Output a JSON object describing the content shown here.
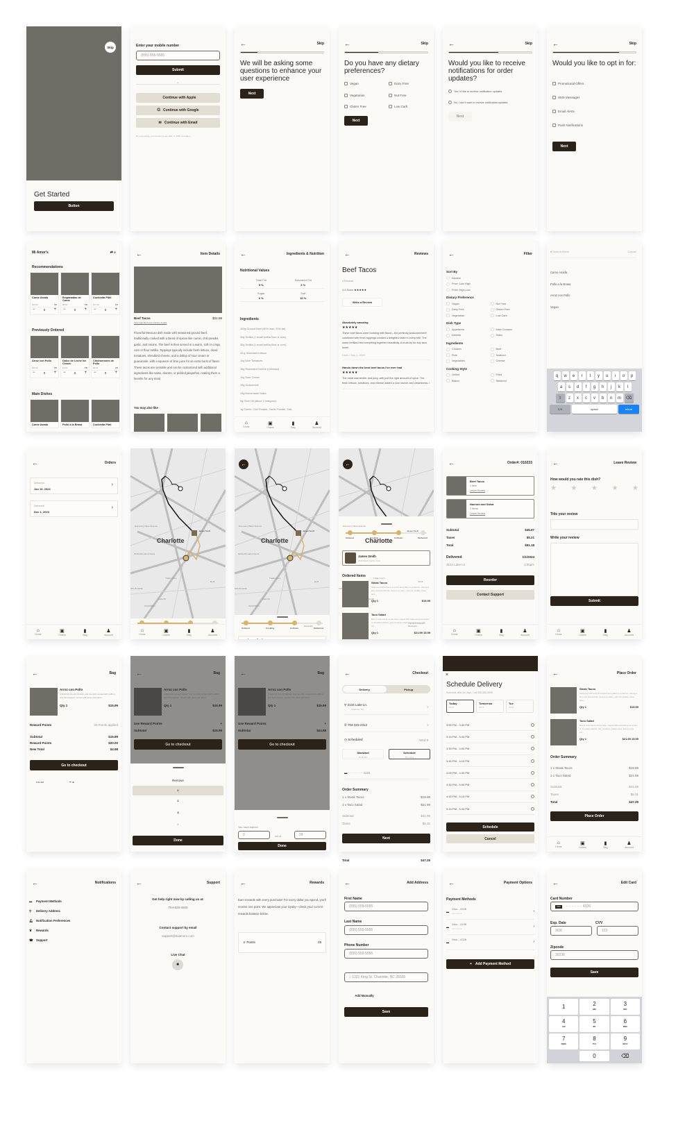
{
  "colors": {
    "primary": "#2b2219",
    "secondary": "#e2ded4",
    "placeholder": "#706d66",
    "accent": "#d9b36c",
    "background": "#fbfaf6",
    "keyboard_return": "#1a82f7"
  },
  "s1": {
    "skip": "Skip",
    "title": "Get Started",
    "button": "Button"
  },
  "s2": {
    "label": "Enter your mobile number",
    "placeholder": "(555) 555-5555",
    "submit": "Submit",
    "or": "or",
    "apple": "Continue with Apple",
    "google": "Continue with Google",
    "email": "Continue with Email",
    "consent": "By proceeding, you consent to get calls, or SMS messages"
  },
  "s3": {
    "skip": "Skip",
    "progress": 0.2,
    "title": "We will be asking some questions to enhance your user experience",
    "next": "Next"
  },
  "s4": {
    "skip": "Skip",
    "progress": 0.4,
    "title": "Do you have any dietary preferences?",
    "options": [
      "Vegan",
      "Dairy Free",
      "Vegetarian",
      "Nut Free",
      "Gluten Free",
      "Low Carb"
    ],
    "next": "Next"
  },
  "s5": {
    "skip": "Skip",
    "progress": 0.6,
    "title": "Would you like to receive notifications for order updates?",
    "options": [
      "Yes I'd like to receive notification updates",
      "No, I don't want to receive notification updates"
    ],
    "next": "Next"
  },
  "s6": {
    "skip": "Skip",
    "progress": 0.8,
    "title": "Would you like to opt in for:",
    "options": [
      "Promotional Offers",
      "SMS Messages",
      "Email Alerts",
      "Push Notifications"
    ],
    "next": "Next"
  },
  "s7": {
    "brand": "Mi Amor's",
    "rec_title": "Recommendations",
    "recs": [
      {
        "name": "Carne Asada",
        "price": "$18.99",
        "rating": "5★",
        "qty": "0"
      },
      {
        "name": "Empanadas de Carne",
        "price": "$8.99",
        "rating": "5★",
        "qty": "0"
      },
      {
        "name": "Cochinita Pibil",
        "price": "$17.99",
        "rating": "4★",
        "qty": "0"
      }
    ],
    "prev_title": "Previously Ordered",
    "prev": [
      {
        "name": "Arroz con Pollo",
        "price": "$15.99",
        "rating": "5★",
        "qty": "0"
      },
      {
        "name": "Dulce de Leche Ice Cream",
        "price": "$4.99",
        "rating": "5★",
        "qty": "0"
      },
      {
        "name": "Chicharrones de Pollo",
        "price": "$8.49",
        "rating": "4★",
        "qty": "0"
      }
    ],
    "main_title": "Main Dishes",
    "mains": [
      "Carne Asada",
      "Pollo a la Brasa",
      "Cochinita Pibil"
    ]
  },
  "s8": {
    "title": "Item Details",
    "name": "Beef Tacos",
    "price": "$21.99",
    "link": "View ingredient and nutrition details",
    "desc": "Flavorful Mexican dish made with seasoned ground beef, traditionally cooked with a blend of spices like cumin, chili powder, garlic, and onions. The beef is then served in a warm, soft or crispy corn or flour tortilla. Toppings typically include fresh lettuce, diced tomatoes, shredded cheese, and a dollop of sour cream or guacamole, with a squeeze of lime juice for an extra burst of flavor. These tacos are versatile and can be customized with additional ingredients like salsa, cilantro, or pickled jalapeños, making them a favorite for any meal.",
    "also": "You may also like"
  },
  "s9": {
    "title": "Ingredients & Nutrition",
    "nv": "Nutritional Values",
    "nutrients": [
      {
        "k": "Total Fat",
        "v": "5 %"
      },
      {
        "k": "Saturated Fat",
        "v": "2 %"
      },
      {
        "k": "Sugar",
        "v": "6 %"
      },
      {
        "k": "Salt",
        "v": "10 %"
      }
    ],
    "ing_title": "Ingredients",
    "ingredients": [
      "100g Ground Beef (80% lean, 20% fat)",
      "30g Tortilla  (1 small tortilla flour or corn)",
      "30g Tortilla  (1 small tortilla flour or corn)",
      "10 g Shredded Lettuce",
      "10g Dice Tomatoes",
      "15g Shredded Cheese (Cheddar)",
      "10g Sour Cream",
      "15g Guacamole",
      "15g Homemade Salsa",
      "5g Olive Oil (about 1 teaspoon)",
      "1g Cumin, Chili Powder, Garlic Powder, Salt,"
    ],
    "nav": [
      "Home",
      "Orders",
      "Bag",
      "Account"
    ]
  },
  "s10": {
    "title": "Reviews",
    "dish": "Beef Tacos",
    "count": "4 Reviews",
    "stars": "4.8 Stars",
    "stars_glyph": "★★★★★",
    "write": "Write a Review",
    "reviews": [
      {
        "title": "Absolutely amazing",
        "body": "These beef tacos were bursting with flavor—the perfectly seasoned beef combined with fresh toppings created a delightful taste in every bite. The warm tortillas held everything together beautifully. A must-try for any taco lover!",
        "meta": "Chris • Sep 1, 2024"
      },
      {
        "title": "Hands down the best beef tacos I've ever had",
        "body": "The meat was tender and juicy, with just the right amount of spice. The fresh lettuce, tomatoes, and cheese added a nice crunch and creaminess. I",
        "meta": ""
      }
    ]
  },
  "s11": {
    "title": "Filter",
    "sort_title": "Sort By",
    "sort": [
      "Newest",
      "Price: Low-High",
      "Price: High-Low"
    ],
    "diet_title": "Dietary Preference",
    "diet": [
      "Vegan",
      "Nut Free",
      "Dairy Free",
      "Gluten Free",
      "Vegetarian",
      "Low Carb"
    ],
    "dish_title": "Dish Type",
    "dish": [
      "Appetizers",
      "Main Courses",
      "Deserts",
      "Sides"
    ],
    "ing_title": "Ingredients",
    "ing": [
      "Chicken",
      "Beef",
      "Pork",
      "Seafood",
      "Vegetables",
      "Cheese"
    ],
    "cook_title": "Cooking Style",
    "cook": [
      "Grilled",
      "Fried",
      "Baked",
      "Steamed"
    ]
  },
  "s12": {
    "placeholder": "Search Menu",
    "cancel": "Cancel",
    "results": [
      "Carne Asada",
      "Pollo a la Brasa",
      "Arroz con Pollo",
      "Vegan"
    ],
    "row1": [
      "q",
      "w",
      "e",
      "r",
      "t",
      "y",
      "u",
      "i",
      "o",
      "p"
    ],
    "row2": [
      "a",
      "s",
      "d",
      "f",
      "g",
      "h",
      "j",
      "k",
      "l"
    ],
    "row3": [
      "z",
      "x",
      "c",
      "v",
      "b",
      "n",
      "m"
    ],
    "k123": "123",
    "space": "space",
    "ret": "return"
  },
  "s13": {
    "title": "Orders",
    "orders": [
      {
        "status": "Delivered",
        "date": "Jan 10, 2024"
      },
      {
        "status": "Delivered",
        "date": "Dec 1, 2023"
      }
    ],
    "nav": [
      "Home",
      "Orders",
      "Bag",
      "Account"
    ]
  },
  "map": {
    "city": "Charlotte",
    "driver": "James Smith",
    "driver_sub": "6 min left",
    "labels": [
      "Discovery Place Science",
      "NASCAR Hall of Fame",
      "Trader Joe's",
      "Latta Pk",
      "DILWORTH",
      "SOUTH END",
      "ELIZ",
      "The Mint Museum Randolph",
      "Little Sugar Creek Greenway",
      "TRYON"
    ]
  },
  "s14": {
    "steps": [
      "Ordered",
      "Cooking",
      "In Route",
      "Delivered"
    ],
    "current_step": 3,
    "nav": [
      "Home",
      "Orders",
      "Bag",
      "Account"
    ]
  },
  "s15": {
    "steps": [
      "Ordered",
      "Cooking",
      "In Route",
      "Delivered"
    ],
    "current_step": 3,
    "driver": "James Smith"
  },
  "s16": {
    "steps": [
      "Ordered",
      "Cooking",
      "In Route",
      "Delivered"
    ],
    "current_step": 3,
    "driver": "James Smith",
    "driver_sub": "2020 Black Hondo Civic",
    "ordered_title": "Ordered Items",
    "items": [
      {
        "name": "Steak Tacos",
        "desc": "Seasoned with a blend of spices and grilled to perfection, offering a juicy and flavorful bite. Served on warm, soft corn tortillas, these taco...",
        "qty": "Qty 1",
        "price": "$15.99"
      },
      {
        "name": "Taco Salad",
        "desc": "Bed of crisp lettuce as the base, topped with seasoned ground beef or shredded chicken, juicy tomatoes, black beans, and crunchy tort...",
        "qty": "Qty 1",
        "price": "$21.99 15.99"
      }
    ]
  },
  "s17": {
    "title": "Order#:  010233",
    "items": [
      {
        "name": "Beef Tacos",
        "count": "1 Item",
        "link": "Leave Review"
      },
      {
        "name": "Nachos and Salsa",
        "count": "2 Items",
        "link": "Leave Review"
      }
    ],
    "subtotal_k": "Subtotal",
    "subtotal": "$45.97",
    "taxes_k": "Taxes",
    "taxes": "$5.21",
    "total_k": "Total",
    "total": "$51.18",
    "delivered": "Delivered",
    "date": "1/1/2024",
    "address": "2134 Lake Ln",
    "time": "1:35pm",
    "reorder": "Reorder",
    "support": "Contact Support",
    "nav": [
      "Home",
      "Orders",
      "Bag",
      "Account"
    ]
  },
  "s18": {
    "title": "Leave Review",
    "q": "How would you rate this dish?",
    "rating": 0,
    "stars": 5,
    "title_label": "Title your review",
    "write_label": "Write your review",
    "submit": "Submit",
    "nav": [
      "Home",
      "Orders",
      "Bag",
      "Account"
    ]
  },
  "s19": {
    "title": "Bag",
    "item": "Arroz con Pollo",
    "desc": "A flavorful one-pot chicken and rice dish cooked with saffron and bell peppers, served with peas and olives.",
    "qty": "Qty 1",
    "price": "$15.99",
    "rp": "Reward Points",
    "rp_val": "20 Points applied",
    "subtotal_k": "Subtotal",
    "subtotal": "$15.99",
    "rew_k": "Reward Points",
    "rew": "$20.00",
    "new_k": "New Total",
    "new": "$4.98",
    "checkout": "Go to checkout",
    "time": "9:41 AM"
  },
  "s20": {
    "title": "Bag",
    "item": "Arroz con Pollo",
    "desc": "A flavorful one-pot chicken and rice dish cooked with saffron and bell peppers, served with peas and olives.",
    "qty": "Qty 1",
    "price": "$15.99",
    "use": "Use Reward Points",
    "plus": "+",
    "subtotal_k": "Subtotal",
    "subtotal": "$15.99",
    "checkout": "Go to checkout",
    "remove": "Remove",
    "picker": [
      "1",
      "2",
      "3",
      "4"
    ],
    "done": "Done"
  },
  "s21": {
    "title": "Bag",
    "item": "Arroz con Pollo",
    "desc": "A flavorful one-pot chicken and rice dish cooked with saffron and bell peppers, served with peas and olives.",
    "qty": "Qty 1",
    "price": "$15.99",
    "use": "Use Reward Points",
    "plus": "+",
    "subtotal_k": "Subtotal",
    "subtotal": "$24.98",
    "checkout": "Go to checkout",
    "earned": "You have earned",
    "val": "0",
    "outof": "out of",
    "max": "29",
    "done": "Done"
  },
  "s22": {
    "title": "Checkout",
    "tabs": [
      "Delivery",
      "Pickup"
    ],
    "addr": "2134 Lake Ln.",
    "addr_sub": "Charlotte, NC",
    "phone": "704-331-2312",
    "sched": "Scheduled",
    "sched_val": "Wed 9",
    "std": "Standard",
    "std_sub": "25-40 mins",
    "sch": "Schedule",
    "sch_sub": "Pick a time",
    "card": "···· ···· ···· 4326",
    "os": "Order Summary",
    "lines": [
      {
        "k": "1 x Steak Tacos",
        "v": "$19.99"
      },
      {
        "k": "1 x Taco Salad",
        "v": "$21.99"
      }
    ],
    "subtotal_k": "Subtotal",
    "subtotal": "$41.98",
    "taxes_k": "Taxes",
    "taxes": "$5.31",
    "total_k": "Total",
    "total": "$47.29",
    "next": "Next"
  },
  "s23": {
    "title": "Schedule Delivery",
    "sub": "Schedule after six days, Call 555-555-5555",
    "days": [
      {
        "d": "Today",
        "s": "Oct 6"
      },
      {
        "d": "Tomorrow",
        "s": "Oct 7"
      },
      {
        "d": "Tue",
        "s": "Oct 8"
      }
    ],
    "slots": [
      "3:00 PM  -  3:30 PM",
      "3:15 PM  -  3:45 PM",
      "3:30 PM  -  4:00 PM",
      "3:45 PM  -  4:15 PM",
      "4:00 PM  -  4:30 PM",
      "4:30 PM  -  5:00 PM",
      "4:45 PM  -  5:15 PM",
      "5:15 PM  -  5:45 PM"
    ],
    "schedule": "Schedule",
    "cancel": "Cancel"
  },
  "s24": {
    "title": "Place Order",
    "items": [
      {
        "name": "Steak Tacos",
        "desc": "Seasoned with a blend of spices and grilled to perfection, offering a juicy and flavorful bite. Served on warm, soft corn tortillas, these taco...",
        "qty": "Qty 1",
        "price": "$15.99"
      },
      {
        "name": "Taco Salad",
        "desc": "Bed of crisp lettuce as the base, topped with seasoned ground beef or shredded chicken, juicy tomatoes, black beans, and crunchy tort...",
        "qty": "Qty 1",
        "price": "$21.99 15.99"
      }
    ],
    "os": "Order Summary",
    "lines": [
      {
        "k": "1 x Steak Tacos",
        "v": "$19.99"
      },
      {
        "k": "1 x Taco Salad",
        "v": "$21.99"
      }
    ],
    "subtotal_k": "Subtotal",
    "subtotal": "$41.98",
    "taxes_k": "Taxes",
    "taxes": "$5.31",
    "total_k": "Total",
    "total": "$47.29",
    "place": "Place Order",
    "nav": [
      "Home",
      "Orders",
      "Bag",
      "Account"
    ]
  },
  "s25": {
    "title": "Notifications",
    "items": [
      "Payment Methods",
      "Delivery Address",
      "Notification Preferences",
      "Rewards",
      "Support"
    ]
  },
  "s26": {
    "title": "Support",
    "call": "Get help right now by calling us at:",
    "phone": "704-529-4500",
    "email_t": "Contact support by email",
    "email": "support@miamors.com",
    "chat": "Live Chat"
  },
  "s27": {
    "title": "Rewards",
    "text": "Earn rewards with every purchase! For every dollar you spend, you'll receive one point. We appreciate your loyalty—check your current rewards balance below.",
    "points_k": "Points",
    "points": "29"
  },
  "s28": {
    "title": "Add Address",
    "fn": "First Name",
    "ln": "Last Name",
    "pn": "Phone Number",
    "ph": "(555) 555-5555",
    "search": "1321 King St. Charlotte, NC 28105",
    "manual": "Add Manually",
    "save": "Save"
  },
  "s29": {
    "title": "Payment Options",
    "pm": "Payment Methods",
    "cards": [
      {
        "n": "Visa....4326",
        "s": "Card expired"
      },
      {
        "n": "Visa....4198",
        "s": "Card expired"
      },
      {
        "n": "Visa....4326",
        "s": ""
      }
    ],
    "add": "Add Payment Method"
  },
  "s30": {
    "title": "Edit Card",
    "cn": "Card Number",
    "cn_val": "···· ···· ···· 4326",
    "exp": "Exp. Date",
    "exp_val": "3/28",
    "cvv": "CVV",
    "cvv_val": "123",
    "zip": "Zipcode",
    "zip_val": "30236",
    "save": "Save",
    "keys": [
      {
        "n": "1",
        "l": ""
      },
      {
        "n": "2",
        "l": "ABC"
      },
      {
        "n": "3",
        "l": "DEF"
      },
      {
        "n": "4",
        "l": "GHI"
      },
      {
        "n": "5",
        "l": "JKL"
      },
      {
        "n": "6",
        "l": "MNO"
      },
      {
        "n": "7",
        "l": "PQRS"
      },
      {
        "n": "8",
        "l": "TUV"
      },
      {
        "n": "9",
        "l": "WXYZ"
      },
      {
        "n": "",
        "l": ""
      },
      {
        "n": "0",
        "l": ""
      },
      {
        "n": "⌫",
        "l": ""
      }
    ]
  }
}
